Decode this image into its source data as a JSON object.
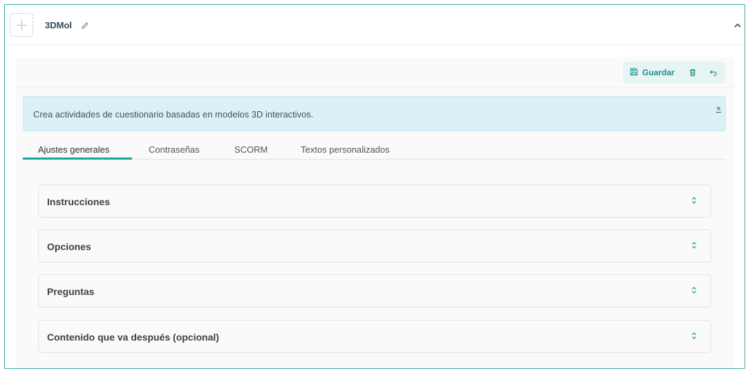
{
  "header": {
    "title": "3DMol",
    "add_icon": "plus-icon",
    "edit_icon": "pencil-icon",
    "collapse_icon": "chevron-up-icon"
  },
  "toolbar": {
    "save_label": "Guardar",
    "save_icon": "floppy-disk-icon",
    "delete_icon": "trash-icon",
    "undo_icon": "undo-icon"
  },
  "info": {
    "text": "Crea actividades de cuestionario basadas en modelos 3D interactivos.",
    "close_label": "×"
  },
  "tabs": [
    {
      "label": "Ajustes generales",
      "active": true
    },
    {
      "label": "Contraseñas",
      "active": false
    },
    {
      "label": "SCORM",
      "active": false
    },
    {
      "label": "Textos personalizados",
      "active": false
    }
  ],
  "panels": [
    {
      "label": "Instrucciones"
    },
    {
      "label": "Opciones"
    },
    {
      "label": "Preguntas"
    },
    {
      "label": "Contenido que va después (opcional)"
    }
  ],
  "colors": {
    "accent": "#1aa29c",
    "frame_border": "#3aa9a6",
    "info_bg": "#dcf0f7"
  }
}
